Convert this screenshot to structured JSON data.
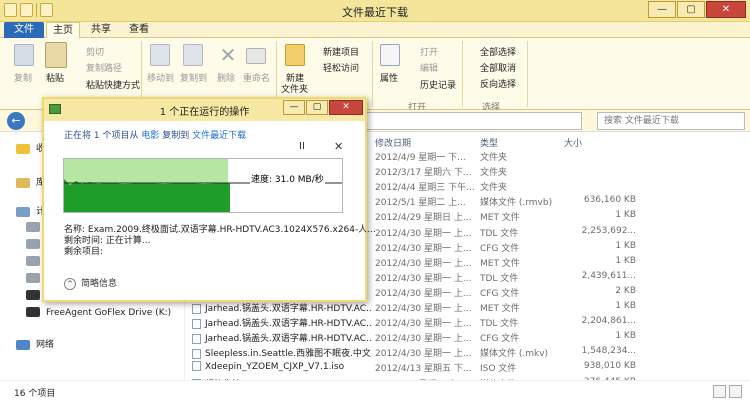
{
  "window": {
    "title": "文件最近下载",
    "min": "—",
    "max": "▢",
    "close": "✕"
  },
  "ribbon_tabs": {
    "file": "文件",
    "home": "主页",
    "share": "共享",
    "view": "查看"
  },
  "ribbon": {
    "copy": "复制",
    "paste": "粘贴",
    "cut": "剪切",
    "copy_path": "复制路径",
    "paste_shortcut": "粘贴快捷方式",
    "move_to": "移动到",
    "copy_to": "复制到",
    "delete": "删除",
    "rename": "重命名",
    "new_folder_line1": "新建",
    "new_folder_line2": "文件夹",
    "new_item": "新建项目",
    "easy_access": "轻松访问",
    "properties": "属性",
    "open": "打开",
    "edit": "编辑",
    "history": "历史记录",
    "select_all": "全部选择",
    "select_none": "全部取消",
    "invert_selection": "反向选择",
    "group_open": "打开",
    "group_select": "选择"
  },
  "search": {
    "placeholder": "搜索 文件最近下载"
  },
  "nav": {
    "back": "←",
    "items": [
      "收",
      "库",
      "计",
      "FreeAgent GoFlex Drive (K:)",
      "网络"
    ]
  },
  "columns": {
    "date": "修改日期",
    "type": "类型",
    "size": "大小"
  },
  "files": [
    {
      "name": "",
      "date": "2012/4/9 星期一 下...",
      "type": "文件夹",
      "size": ""
    },
    {
      "name": "",
      "date": "2012/3/17 星期六 下...",
      "type": "文件夹",
      "size": ""
    },
    {
      "name": "",
      "date": "2012/4/4 星期三 下午...",
      "type": "文件夹",
      "size": ""
    },
    {
      "name": "",
      "date": "2012/5/1 星期二 上...",
      "type": "媒体文件 (.rmvb)",
      "size": "636,160 KB"
    },
    {
      "name": "",
      "date": "2012/4/29 星期日 上...",
      "type": "MET 文件",
      "size": "1 KB"
    },
    {
      "name": "",
      "date": "2012/4/30 星期一 上...",
      "type": "TDL 文件",
      "size": "2,253,692..."
    },
    {
      "name": "",
      "date": "2012/4/30 星期一 上...",
      "type": "CFG 文件",
      "size": "1 KB"
    },
    {
      "name": "",
      "date": "2012/4/30 星期一 上...",
      "type": "MET 文件",
      "size": "1 KB"
    },
    {
      "name": "",
      "date": "2012/4/30 星期一 上...",
      "type": "TDL 文件",
      "size": "2,439,611..."
    },
    {
      "name": "",
      "date": "2012/4/30 星期一 上...",
      "type": "CFG 文件",
      "size": "2 KB"
    },
    {
      "name": "Jarhead.锅盖头.双语字幕.HR-HDTV.AC...",
      "date": "2012/4/30 星期一 上...",
      "type": "MET 文件",
      "size": "1 KB"
    },
    {
      "name": "Jarhead.锅盖头.双语字幕.HR-HDTV.AC...",
      "date": "2012/4/30 星期一 上...",
      "type": "TDL 文件",
      "size": "2,204,861..."
    },
    {
      "name": "Jarhead.锅盖头.双语字幕.HR-HDTV.AC...",
      "date": "2012/4/30 星期一 上...",
      "type": "CFG 文件",
      "size": "1 KB"
    },
    {
      "name": "Sleepless.in.Seattle.西雅图不眠夜.中文...",
      "date": "2012/4/30 星期一 上...",
      "type": "媒体文件 (.mkv)",
      "size": "1,548,234..."
    },
    {
      "name": "Xdeepin_YZOEM_CJXP_V7.1.iso",
      "date": "2012/4/13 星期五 下...",
      "type": "ISO 文件",
      "size": "938,010 KB"
    },
    {
      "name": "超能失控.Chronicle.2012.DVD-RMVB.r...",
      "date": "2012/5/1 星期二 上...",
      "type": "媒体文件 (.rmvb)",
      "size": "376,445 KB"
    }
  ],
  "status": {
    "count": "16 个项目"
  },
  "dialog": {
    "title": "1 个正在运行的操作",
    "prefix": "正在将 1 个项目从",
    "source": "电影",
    "middle": "复制到",
    "dest": "文件最近下载",
    "pause": "II",
    "cancel": "✕",
    "speed": "速度: 31.0 MB/秒",
    "progress_fraction": 0.59,
    "name_label": "名称:",
    "name_value": "Exam.2009.终极面试.双语字幕.HR-HDTV.AC3.1024X576.x264-人...",
    "time_label": "剩余时间:",
    "time_value": "正在计算...",
    "items_label": "剩余项目:",
    "items_value": "",
    "less_info": "简略信息",
    "less_icon": "^"
  }
}
